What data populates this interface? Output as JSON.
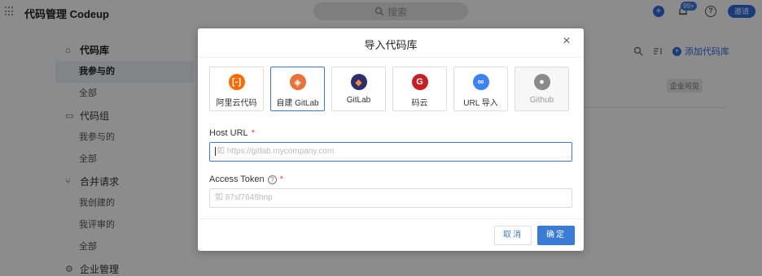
{
  "app": {
    "title": "代码管理 Codeup",
    "search_placeholder": "搜索",
    "notif_badge": "99+",
    "invite": "邀请"
  },
  "sidebar": {
    "groups": [
      {
        "label": "代码库",
        "items": [
          "我参与的",
          "全部"
        ]
      },
      {
        "label": "代码组",
        "items": [
          "我参与的",
          "全部"
        ]
      },
      {
        "label": "合并请求",
        "items": [
          "我创建的",
          "我评审的",
          "全部"
        ]
      },
      {
        "label": "企业管理",
        "items": []
      }
    ]
  },
  "toolbar": {
    "add_repo": "添加代码库"
  },
  "repo_row": {
    "visibility": "企业可见"
  },
  "modal": {
    "title": "导入代码库",
    "sources": [
      {
        "label": "阿里云代码",
        "icon": "aliyun-icon",
        "color": "#ff6a00",
        "glyph": "[-]"
      },
      {
        "label": "自建 GitLab",
        "icon": "gitlab-self-icon",
        "color": "#e8733a",
        "glyph": "◈"
      },
      {
        "label": "GitLab",
        "icon": "gitlab-icon",
        "color": "#2c2f6b",
        "glyph": "◆"
      },
      {
        "label": "码云",
        "icon": "gitee-icon",
        "color": "#c71d23",
        "glyph": "G"
      },
      {
        "label": "URL 导入",
        "icon": "link-icon",
        "color": "#3b82f6",
        "glyph": "∞"
      },
      {
        "label": "Github",
        "icon": "github-icon",
        "color": "#8a8a8a",
        "glyph": "●"
      }
    ],
    "host_label": "Host URL",
    "host_placeholder": "如 https://gitlab.mycompany.com",
    "token_label": "Access Token",
    "token_placeholder": "如 87sf7648hnp",
    "required_mark": "*",
    "cancel": "取消",
    "ok": "确定"
  }
}
